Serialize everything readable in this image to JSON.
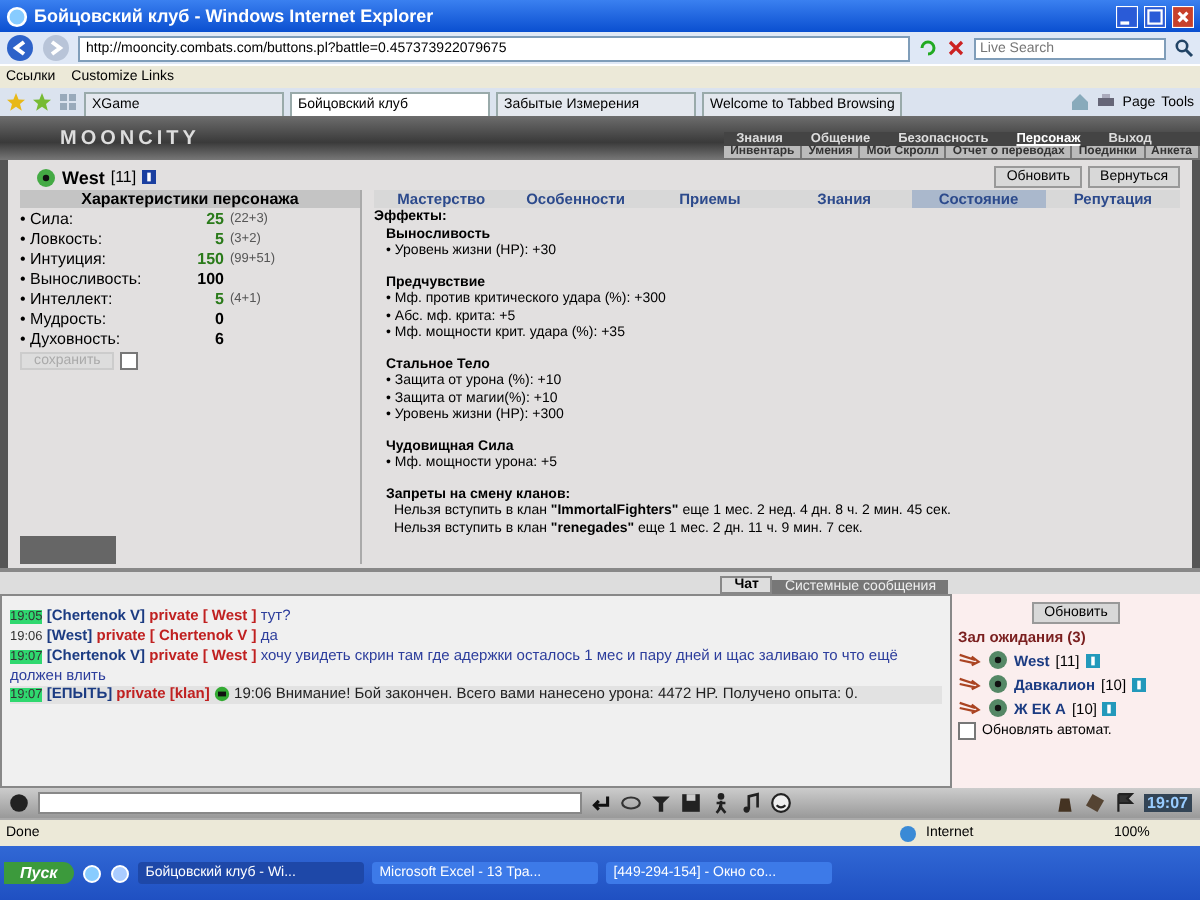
{
  "window": {
    "title": "Бойцовский клуб - Windows Internet Explorer"
  },
  "address_bar": {
    "url": "http://mooncity.combats.com/buttons.pl?battle=0.457373922079675",
    "search_placeholder": "Live Search"
  },
  "links_bar": {
    "label": "Ссылки",
    "items": [
      "Customize Links"
    ]
  },
  "browser_tabs": [
    {
      "label": "XGame",
      "selected": false
    },
    {
      "label": "Бойцовский клуб",
      "selected": true
    },
    {
      "label": "Забытые Измерения",
      "selected": false
    },
    {
      "label": "Welcome to Tabbed Browsing",
      "selected": false
    }
  ],
  "browser_tools": [
    "Page",
    "Tools"
  ],
  "game_header": {
    "logo": "MOONCITY",
    "menu": [
      {
        "label": "Знания",
        "selected": false
      },
      {
        "label": "Общение",
        "selected": false
      },
      {
        "label": "Безопасность",
        "selected": false
      },
      {
        "label": "Персонаж",
        "selected": true
      },
      {
        "label": "Выход",
        "selected": false
      }
    ],
    "submenu": [
      "Инвентарь",
      "Умения",
      "Мой Скролл",
      "Отчет о переводах",
      "Поединки",
      "Анкета"
    ]
  },
  "player": {
    "name": "West",
    "level": "[11]",
    "buttons": [
      "Обновить",
      "Вернуться"
    ]
  },
  "stats_panel": {
    "title": "Характеристики персонажа",
    "save_button": "сохранить",
    "checkbox_checked": false,
    "stats": [
      {
        "name": "• Сила:",
        "value": "25",
        "bonus": "(22+3)",
        "boosted": true
      },
      {
        "name": "• Ловкость:",
        "value": "5",
        "bonus": "(3+2)",
        "boosted": true
      },
      {
        "name": "• Интуиция:",
        "value": "150",
        "bonus": "(99+51)",
        "boosted": true
      },
      {
        "name": "• Выносливость:",
        "value": "100",
        "boosted": false
      },
      {
        "name": "• Интеллект:",
        "value": "5",
        "bonus": "(4+1)",
        "boosted": true
      },
      {
        "name": "• Мудрость:",
        "value": "0",
        "boosted": false
      },
      {
        "name": "• Духовность:",
        "value": "6",
        "boosted": false
      }
    ]
  },
  "tabs": [
    {
      "label": "Мастерство",
      "selected": false
    },
    {
      "label": "Особенности",
      "selected": false
    },
    {
      "label": "Приемы",
      "selected": false
    },
    {
      "label": "Знания",
      "selected": false
    },
    {
      "label": "Состояние",
      "selected": true
    },
    {
      "label": "Репутация",
      "selected": false
    }
  ],
  "effects": {
    "title": "Эффекты:",
    "groups": [
      {
        "name": "Выносливость",
        "lines": [
          "• Уровень жизни (HP): +30"
        ]
      },
      {
        "name": "Предчувствие",
        "lines": [
          "• Мф. против критического удара (%): +300",
          "• Абс. мф. крита: +5",
          "• Мф. мощности крит. удара (%): +35"
        ]
      },
      {
        "name": "Стальное Тело",
        "lines": [
          "• Защита от урона (%): +10",
          "• Защита от магии(%): +10",
          "• Уровень жизни (HP): +300"
        ]
      },
      {
        "name": "Чудовищная Сила",
        "lines": [
          "• Мф. мощности урона: +5"
        ]
      }
    ],
    "bans_title": "Запреты на смену кланов:",
    "bans": [
      "Нельзя вступить в клан **\"ImmortalFighters\"** еще 1 мес. 2 нед. 4 дн. 8 ч. 2 мин. 45 сек.",
      "Нельзя вступить в клан **\"renegades\"** еще 1 мес. 2 дн. 11 ч. 9 мин. 7 сек."
    ]
  },
  "chat_tabs": [
    {
      "label": "Чат",
      "selected": true
    },
    {
      "label": "Системные сообщения",
      "selected": false
    }
  ],
  "chat": [
    {
      "time": "19:05",
      "highlighted": true,
      "sender": "[Chertenok V]",
      "target": "private [ West ]",
      "text": "тут?",
      "kind": "message"
    },
    {
      "time": "19:06",
      "highlighted": false,
      "sender": "[West]",
      "target": "private [ Chertenok V ]",
      "text": "да",
      "kind": "message"
    },
    {
      "time": "19:07",
      "highlighted": true,
      "sender": "[Chertenok V]",
      "target": "private [ West ]",
      "text": "хочу увидеть скрин там где адержки осталось 1 мес и пару дней и щас заливаю то что ещё должен влить",
      "kind": "message"
    },
    {
      "time": "19:07",
      "highlighted": true,
      "sender": "[ЕПЫТЬ]",
      "target": "private [klan]",
      "text": "19:06 Внимание! Бой закончен. Всего вами нанесено урона: 4472 HP. Получено опыта: 0.",
      "kind": "system"
    }
  ],
  "waiting_room": {
    "refresh_button": "Обновить",
    "title": "Зал ожидания (3)",
    "players": [
      {
        "name": "West",
        "level": "[11]"
      },
      {
        "name": "Давкалион",
        "level": "[10]"
      },
      {
        "name": "Ж ЕК А",
        "level": "[10]"
      }
    ],
    "auto_refresh_label": "Обновлять автомат.",
    "auto_refresh": false
  },
  "chat_clock": "19:07",
  "status_bar": {
    "text": "Done",
    "zone": "Internet",
    "zoom": "100%"
  },
  "taskbar": {
    "start": "Пуск",
    "windows": [
      {
        "label": "Бойцовский клуб - Wi...",
        "selected": true
      },
      {
        "label": "Microsoft Excel - 13 Тра...",
        "selected": false
      },
      {
        "label": "[449-294-154] - Окно со...",
        "selected": false
      }
    ]
  }
}
